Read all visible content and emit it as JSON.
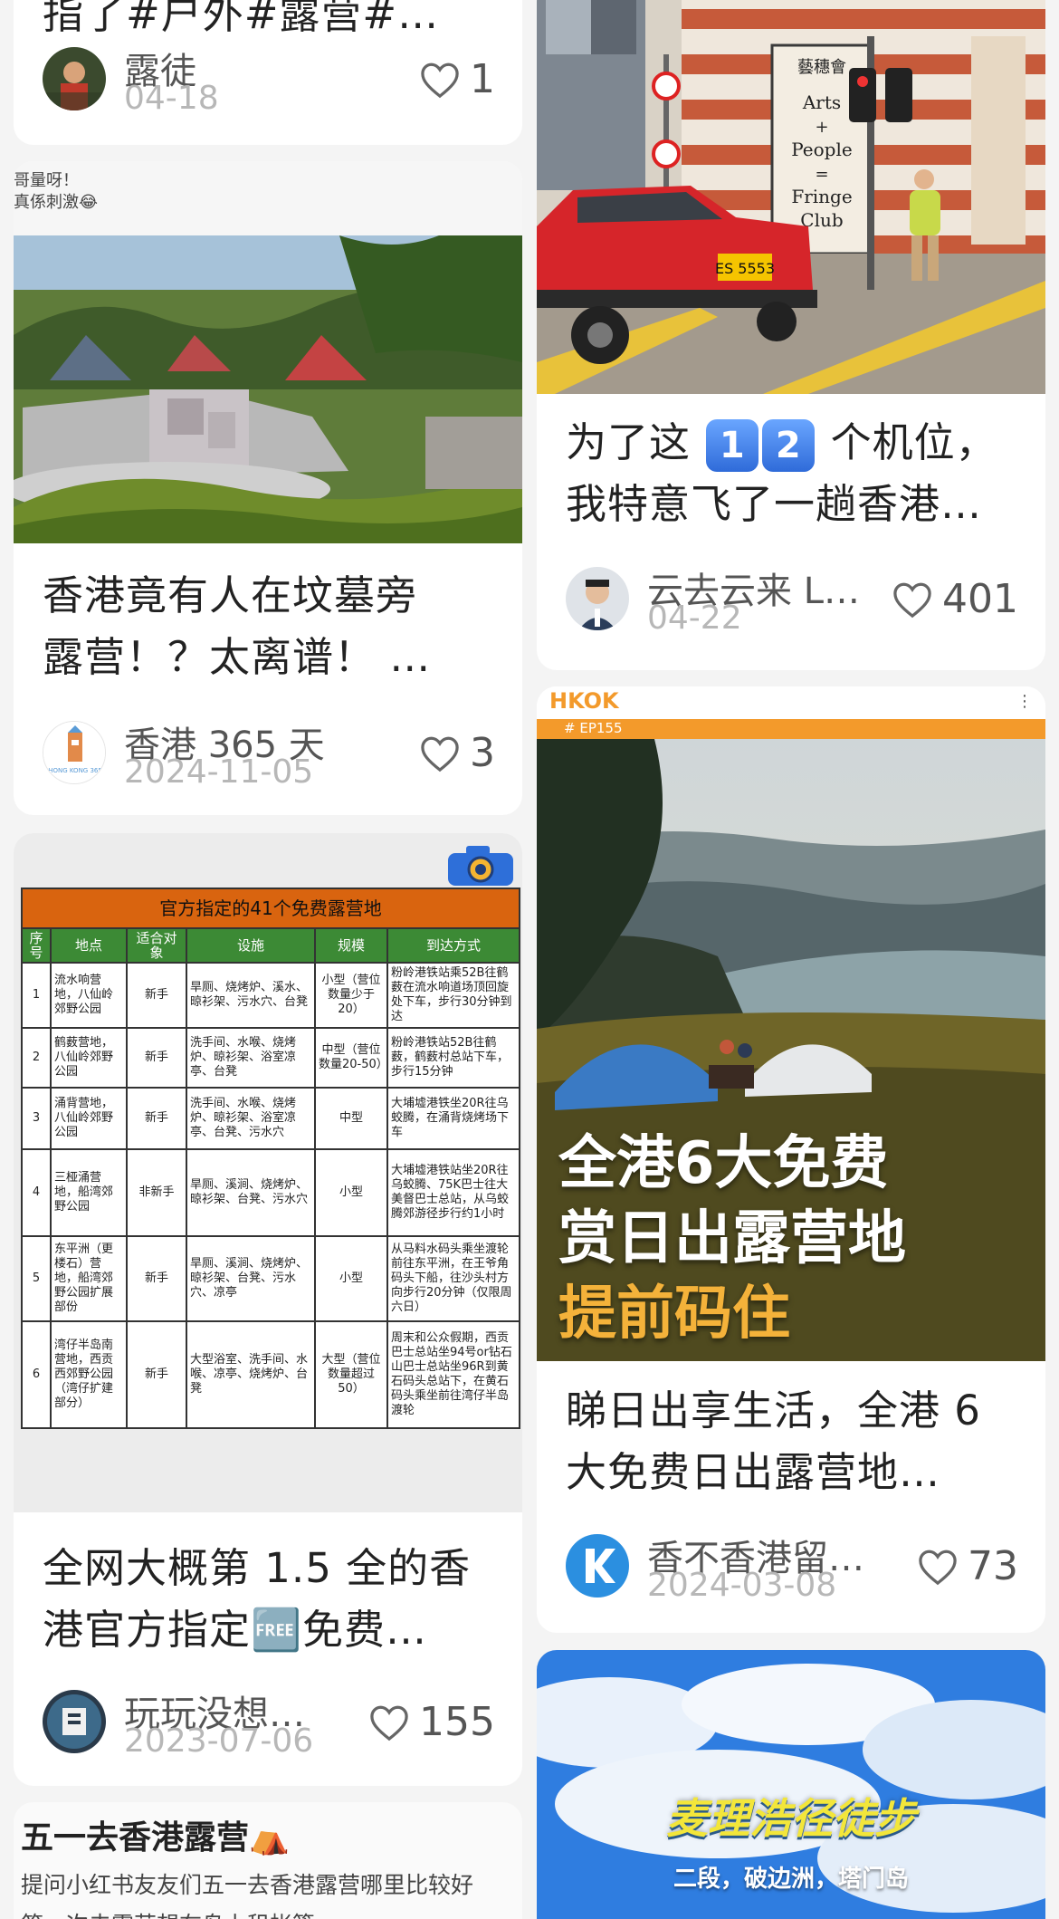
{
  "feed": {
    "left": [
      {
        "title_lines": [
          "指了#户外#露营#…"
        ],
        "author": "露徒",
        "date": "04-18",
        "likes": "1"
      },
      {
        "image_caption_lines": [
          "哥量呀！",
          "真係刺激😂"
        ],
        "title_lines": [
          "香港竟有人在坟墓旁",
          "露营！？太离谱！ …"
        ],
        "author": "香港 365 天",
        "avatar_text": "HONG KONG 365",
        "date": "2024-11-05",
        "likes": "3"
      },
      {
        "table": {
          "caption": "官方指定的41个免费露营地",
          "headers": [
            "序号",
            "地点",
            "适合对象",
            "设施",
            "规模",
            "到达方式"
          ],
          "rows": [
            [
              "1",
              "流水响营地，八仙岭郊野公园",
              "新手",
              "旱厕、烧烤炉、溪水、晾衫架、污水穴、台凳",
              "小型（营位数量少于20）",
              "粉岭港铁站乘52B往鹤薮在流水响道场顶回旋处下车，步行30分钟到达"
            ],
            [
              "2",
              "鹤薮营地，八仙岭郊野公园",
              "新手",
              "洗手间、水喉、烧烤炉、晾衫架、浴室凉亭、台凳",
              "中型（营位数量20-50）",
              "粉岭港铁站52B往鹤薮，鹤薮村总站下车，步行15分钟"
            ],
            [
              "3",
              "涌背营地，八仙岭郊野公园",
              "新手",
              "洗手间、水喉、烧烤炉、晾衫架、浴室凉亭、台凳、污水穴",
              "中型",
              "大埔墟港铁坐20R往乌蛟腾，在涌背烧烤场下车"
            ],
            [
              "4",
              "三桠涌营地，船湾郊野公园",
              "非新手",
              "旱厕、溪涧、烧烤炉、晾衫架、台凳、污水穴",
              "小型",
              "大埔墟港铁站坐20R往乌蛟腾、75K巴士往大美督巴士总站，从乌蛟腾郊游径步行约1小时"
            ],
            [
              "5",
              "东平洲（更楼石）营地，船湾郊野公园扩展部份",
              "新手",
              "旱厕、溪涧、烧烤炉、晾衫架、台凳、污水穴、凉亭",
              "小型",
              "从马料水码头乘坐渡轮前往东平洲，在王爷角码头下船，往沙头村方向步行20分钟（仅限周六日）"
            ],
            [
              "6",
              "湾仔半岛南营地，西贡西郊野公园（湾仔扩建部分）",
              "新手",
              "大型浴室、洗手间、水喉、凉亭、烧烤炉、台凳",
              "大型（营位数量超过50）",
              "周末和公众假期，西贡巴士总站坐94号or钻石山巴士总站坐96R到黄石码头总站下，在黄石码头乘坐前往湾仔半岛渡轮"
            ]
          ]
        },
        "title_lines": [
          "全网大概第 1.5 全的香",
          "港官方指定🆓免费…"
        ],
        "author": "玩玩没想…",
        "date": "2023-07-06",
        "likes": "155"
      },
      {
        "title": "五一去香港露营⛺",
        "body_lines": [
          "提问小红书友友们五一去香港露营哪里比较好",
          "第一次去露营想在岛上租帐篷"
        ]
      }
    ],
    "right": [
      {
        "image_signs": [
          "藝穗會",
          "Arts",
          "+",
          "People",
          "=",
          "Fringe",
          "Club"
        ],
        "taxi_plate": "ES 5553",
        "title_lines": [
          "为了这 1 2 个机位，",
          "我特意飞了一趟香港…"
        ],
        "emoji_digits": [
          "1",
          "2"
        ],
        "author": "云去云来 L…",
        "date": "04-22",
        "likes": "401"
      },
      {
        "image_header": "HKOK",
        "image_tag": "# EP155",
        "image_overlay": [
          "全港6大免费",
          "赏日出露营地",
          "提前码住"
        ],
        "title_lines": [
          "睇日出享生活，全港 6",
          "大免费日出露营地…"
        ],
        "author": "香不香港留…",
        "date": "2024-03-08",
        "likes": "73"
      },
      {
        "image_overlay": [
          "麦理浩径徒步",
          "二段，破边洲，塔门岛"
        ]
      }
    ]
  },
  "colors": {
    "background": "#f4f4f4",
    "card": "#ffffff",
    "text": "#222222",
    "muted": "#b7b7b7",
    "overlay_yellow": "#f4b23a",
    "hkok_orange": "#f39a2b"
  }
}
